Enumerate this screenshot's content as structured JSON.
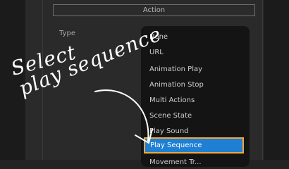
{
  "section": {
    "title": "Action"
  },
  "type_field": {
    "label": "Type",
    "options": [
      "None",
      "URL",
      "Animation Play",
      "Animation Stop",
      "Multi Actions",
      "Scene State",
      "Play Sound",
      "Play Sequence",
      "Movement Tr..."
    ],
    "selected": "Play Sequence"
  },
  "annotation": {
    "line1": "Select",
    "line2": "play sequence"
  },
  "colors": {
    "selection": "#1f7fd3",
    "selection_border": "#f0a83a",
    "dropdown_bg": "#141414"
  }
}
